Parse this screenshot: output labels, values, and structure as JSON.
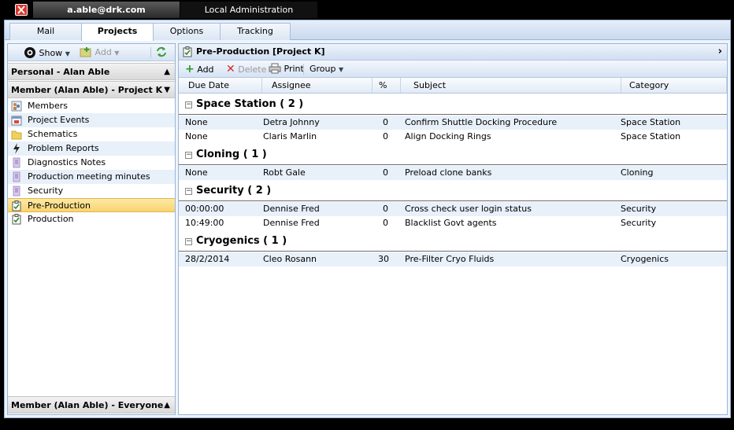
{
  "window": {
    "user_tab": "a.able@drk.com",
    "admin_tab": "Local Administration"
  },
  "tabs": [
    {
      "label": "Mail"
    },
    {
      "label": "Projects"
    },
    {
      "label": "Options"
    },
    {
      "label": "Tracking"
    }
  ],
  "left_toolbar": {
    "show_label": "Show",
    "add_label": "Add"
  },
  "left": {
    "personal_header": "Personal - Alan Able",
    "member_header": "Member (Alan Able) - Project K",
    "bottom_header": "Member (Alan Able) - Everyone in",
    "items": [
      {
        "label": "Members",
        "icon": "members-icon"
      },
      {
        "label": "Project Events",
        "icon": "calendar-icon"
      },
      {
        "label": "Schematics",
        "icon": "folder-icon"
      },
      {
        "label": "Problem Reports",
        "icon": "lightning-icon"
      },
      {
        "label": "Diagnostics Notes",
        "icon": "notes-icon"
      },
      {
        "label": "Production meeting minutes",
        "icon": "notes-icon"
      },
      {
        "label": "Security",
        "icon": "notes-icon"
      },
      {
        "label": "Pre-Production",
        "icon": "task-icon"
      },
      {
        "label": "Production",
        "icon": "task-icon"
      }
    ],
    "selected": "Pre-Production"
  },
  "right": {
    "title": "Pre-Production [Project K]",
    "toolbar": {
      "add_label": "Add",
      "delete_label": "Delete",
      "print_label": "Print",
      "group_label": "Group"
    },
    "columns": [
      "Due Date",
      "Assignee",
      "%",
      "Subject",
      "Category"
    ],
    "groups": [
      {
        "title": "Space Station ( 2 )",
        "rows": [
          {
            "due": "None",
            "assignee": "Detra Johnny",
            "pct": "0",
            "subject": "Confirm Shuttle Docking Procedure",
            "category": "Space Station"
          },
          {
            "due": "None",
            "assignee": "Claris Marlin",
            "pct": "0",
            "subject": "Align Docking Rings",
            "category": "Space Station"
          }
        ]
      },
      {
        "title": "Cloning ( 1 )",
        "rows": [
          {
            "due": "None",
            "assignee": "Robt Gale",
            "pct": "0",
            "subject": "Preload clone banks",
            "category": "Cloning"
          }
        ]
      },
      {
        "title": "Security ( 2 )",
        "rows": [
          {
            "due": "00:00:00",
            "assignee": "Dennise Fred",
            "pct": "0",
            "subject": "Cross check user login status",
            "category": "Security"
          },
          {
            "due": "10:49:00",
            "assignee": "Dennise Fred",
            "pct": "0",
            "subject": "Blacklist Govt agents",
            "category": "Security"
          }
        ]
      },
      {
        "title": "Cryogenics ( 1 )",
        "rows": [
          {
            "due": "28/2/2014",
            "assignee": "Cleo Rosann",
            "pct": "30",
            "subject": "Pre-Filter Cryo Fluids",
            "category": "Cryogenics"
          }
        ]
      }
    ]
  },
  "colors": {
    "accent": "#9ab4d4",
    "selected_bg": "#f8d470",
    "alt_row": "#e8f0fa",
    "close_red": "#e0332b"
  }
}
